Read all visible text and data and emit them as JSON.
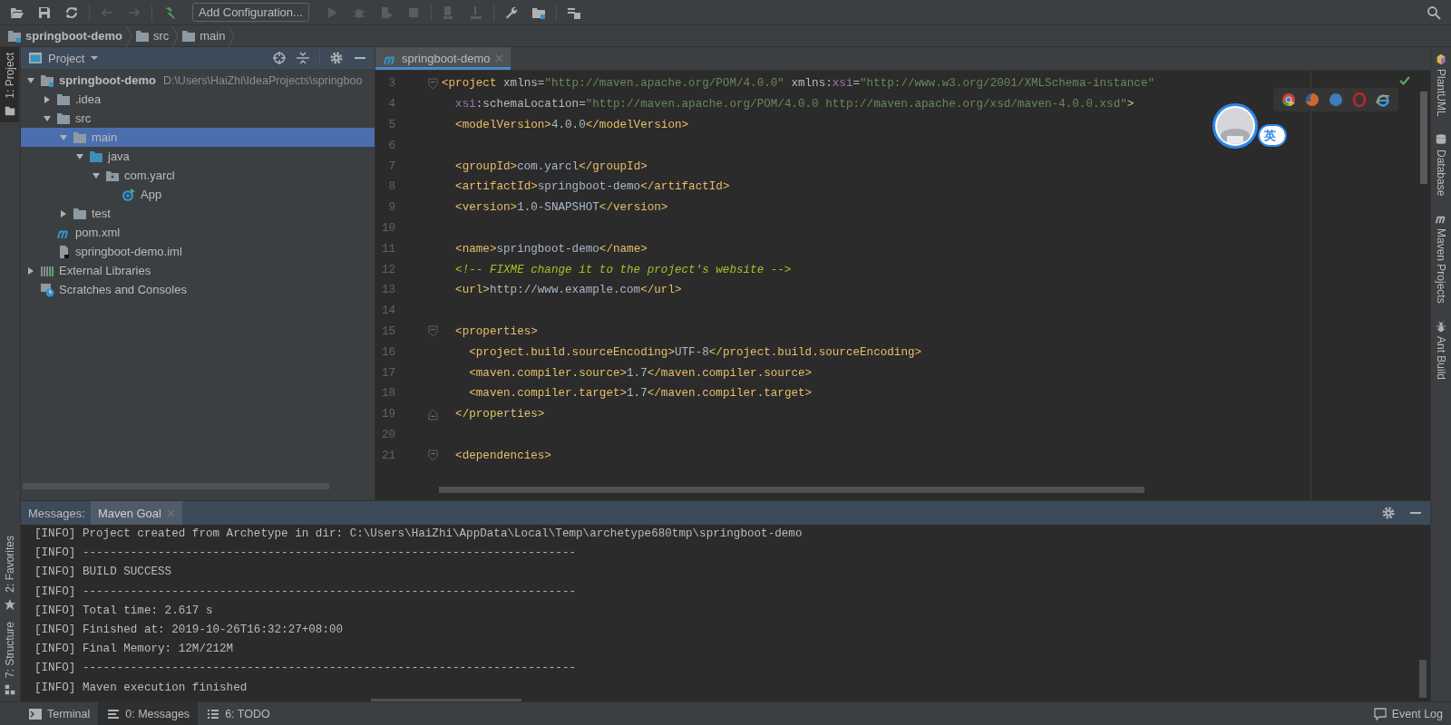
{
  "toolbar": {
    "config_button": "Add Configuration..."
  },
  "breadcrumbs": [
    {
      "label": "springboot-demo",
      "kind": "module"
    },
    {
      "label": "src",
      "kind": "folder"
    },
    {
      "label": "main",
      "kind": "folder"
    }
  ],
  "left_strip": {
    "top": [
      {
        "label": "1: Project",
        "kind": "project",
        "selected": true
      }
    ],
    "bottom": [
      {
        "label": "2: Favorites",
        "kind": "favorites",
        "selected": false
      },
      {
        "label": "7: Structure",
        "kind": "structure",
        "selected": false
      }
    ]
  },
  "project_panel": {
    "title": "Project",
    "tree": [
      {
        "label": "springboot-demo",
        "hint": "D:\\Users\\HaiZhi\\IdeaProjects\\springboo",
        "kind": "module",
        "expanded": true,
        "selected": false,
        "children": [
          {
            "label": ".idea",
            "kind": "folder",
            "expanded": false,
            "selected": false
          },
          {
            "label": "src",
            "kind": "folder",
            "expanded": true,
            "selected": false,
            "children": [
              {
                "label": "main",
                "kind": "folder",
                "expanded": true,
                "selected": true,
                "children": [
                  {
                    "label": "java",
                    "kind": "source",
                    "expanded": true,
                    "selected": false,
                    "children": [
                      {
                        "label": "com.yarcl",
                        "kind": "package",
                        "expanded": true,
                        "selected": false,
                        "children": [
                          {
                            "label": "App",
                            "kind": "class",
                            "selected": false
                          }
                        ]
                      }
                    ]
                  }
                ]
              },
              {
                "label": "test",
                "kind": "folder",
                "expanded": false,
                "selected": false
              }
            ]
          },
          {
            "label": "pom.xml",
            "kind": "maven",
            "selected": false
          },
          {
            "label": "springboot-demo.iml",
            "kind": "iml",
            "selected": false
          }
        ]
      },
      {
        "label": "External Libraries",
        "kind": "libraries",
        "expanded": false,
        "selected": false
      },
      {
        "label": "Scratches and Consoles",
        "kind": "scratches",
        "selected": false
      }
    ]
  },
  "editor": {
    "tabs": [
      {
        "label": "springboot-demo",
        "selected": true
      }
    ],
    "lines": [
      {
        "number": "3",
        "kind": "fold_start",
        "tokens": [
          {
            "kind": "tag",
            "text": "<project"
          },
          {
            "kind": "attr",
            "text": " xmlns="
          },
          {
            "kind": "str",
            "text": "\"http://maven.apache.org/POM/4.0.0\""
          },
          {
            "kind": "attr",
            "text": " xmlns:"
          },
          {
            "kind": "ns",
            "text": "xsi"
          },
          {
            "kind": "attr",
            "text": "="
          },
          {
            "kind": "str",
            "text": "\"http://www.w3.org/2001/XMLSchema-instance\""
          }
        ]
      },
      {
        "number": "4",
        "tokens": [
          {
            "kind": "ns",
            "text": "  xsi"
          },
          {
            "kind": "attr",
            "text": ":schemaLocation="
          },
          {
            "kind": "str",
            "text": "\"http://maven.apache.org/POM/4.0.0 http://maven.apache.org/xsd/maven-4.0.0.xsd\""
          },
          {
            "kind": "tag",
            "text": ">"
          }
        ]
      },
      {
        "number": "5",
        "tokens": [
          {
            "kind": "tag",
            "text": "  <modelVersion>"
          },
          {
            "kind": "text",
            "text": "4.0.0"
          },
          {
            "kind": "tag",
            "text": "</modelVersion>"
          }
        ]
      },
      {
        "number": "6",
        "kind": "plain"
      },
      {
        "number": "7",
        "tokens": [
          {
            "kind": "tag",
            "text": "  <groupId>"
          },
          {
            "kind": "text",
            "text": "com.yarcl"
          },
          {
            "kind": "tag",
            "text": "</groupId>"
          }
        ]
      },
      {
        "number": "8",
        "tokens": [
          {
            "kind": "tag",
            "text": "  <artifactId>"
          },
          {
            "kind": "text",
            "text": "springboot-demo"
          },
          {
            "kind": "tag",
            "text": "</artifactId>"
          }
        ]
      },
      {
        "number": "9",
        "tokens": [
          {
            "kind": "tag",
            "text": "  <version>"
          },
          {
            "kind": "text",
            "text": "1.0-SNAPSHOT"
          },
          {
            "kind": "tag",
            "text": "</version>"
          }
        ]
      },
      {
        "number": "10",
        "kind": "plain"
      },
      {
        "number": "11",
        "tokens": [
          {
            "kind": "tag",
            "text": "  <name>"
          },
          {
            "kind": "text",
            "text": "springboot-demo"
          },
          {
            "kind": "tag",
            "text": "</name>"
          }
        ]
      },
      {
        "number": "12",
        "tokens": [
          {
            "kind": "comment",
            "text": "  <!-- FIXME change it to the project's website -->"
          }
        ]
      },
      {
        "number": "13",
        "tokens": [
          {
            "kind": "tag",
            "text": "  <url>"
          },
          {
            "kind": "text",
            "text": "http://www.example.com"
          },
          {
            "kind": "tag",
            "text": "</url>"
          }
        ]
      },
      {
        "number": "14",
        "kind": "plain"
      },
      {
        "number": "15",
        "kind": "fold_start",
        "tokens": [
          {
            "kind": "tag",
            "text": "  <properties>"
          }
        ]
      },
      {
        "number": "16",
        "tokens": [
          {
            "kind": "tag",
            "text": "    <project.build.sourceEncoding>"
          },
          {
            "kind": "text",
            "text": "UTF-8"
          },
          {
            "kind": "tag",
            "text": "</project.build.sourceEncoding>"
          }
        ]
      },
      {
        "number": "17",
        "tokens": [
          {
            "kind": "tag",
            "text": "    <maven.compiler.source>"
          },
          {
            "kind": "text",
            "text": "1.7"
          },
          {
            "kind": "tag",
            "text": "</maven.compiler.source>"
          }
        ]
      },
      {
        "number": "18",
        "tokens": [
          {
            "kind": "tag",
            "text": "    <maven.compiler.target>"
          },
          {
            "kind": "text",
            "text": "1.7"
          },
          {
            "kind": "tag",
            "text": "</maven.compiler.target>"
          }
        ]
      },
      {
        "number": "19",
        "kind": "fold_end",
        "tokens": [
          {
            "kind": "tag",
            "text": "  </properties>"
          }
        ]
      },
      {
        "number": "20",
        "kind": "plain"
      },
      {
        "number": "21",
        "kind": "fold_start",
        "tokens": [
          {
            "kind": "tag",
            "text": "  <dependencies>"
          }
        ]
      }
    ]
  },
  "ime_indicator": {
    "label": "英"
  },
  "right_strip": [
    {
      "label": "PlantUML",
      "kind": "plantuml"
    },
    {
      "label": "Database",
      "kind": "database"
    },
    {
      "label": "Maven Projects",
      "kind": "maven"
    },
    {
      "label": "Ant Build",
      "kind": "ant"
    }
  ],
  "messages_panel": {
    "title": "Messages:",
    "tabs": [
      {
        "label": "Maven Goal",
        "selected": true
      }
    ],
    "lines": [
      "[INFO] Project created from Archetype in dir: C:\\Users\\HaiZhi\\AppData\\Local\\Temp\\archetype680tmp\\springboot-demo",
      "[INFO] ------------------------------------------------------------------------",
      "[INFO] BUILD SUCCESS",
      "[INFO] ------------------------------------------------------------------------",
      "[INFO] Total time: 2.617 s",
      "[INFO] Finished at: 2019-10-26T16:32:27+08:00",
      "[INFO] Final Memory: 12M/212M",
      "[INFO] ------------------------------------------------------------------------",
      "[INFO] Maven execution finished"
    ]
  },
  "bottom_bar": {
    "tools": [
      {
        "label": "Terminal",
        "kind": "terminal",
        "selected": false
      },
      {
        "label": "0: Messages",
        "kind": "messages",
        "selected": true
      },
      {
        "label": "6: TODO",
        "kind": "todo",
        "selected": false
      }
    ],
    "event_log": "Event Log"
  }
}
